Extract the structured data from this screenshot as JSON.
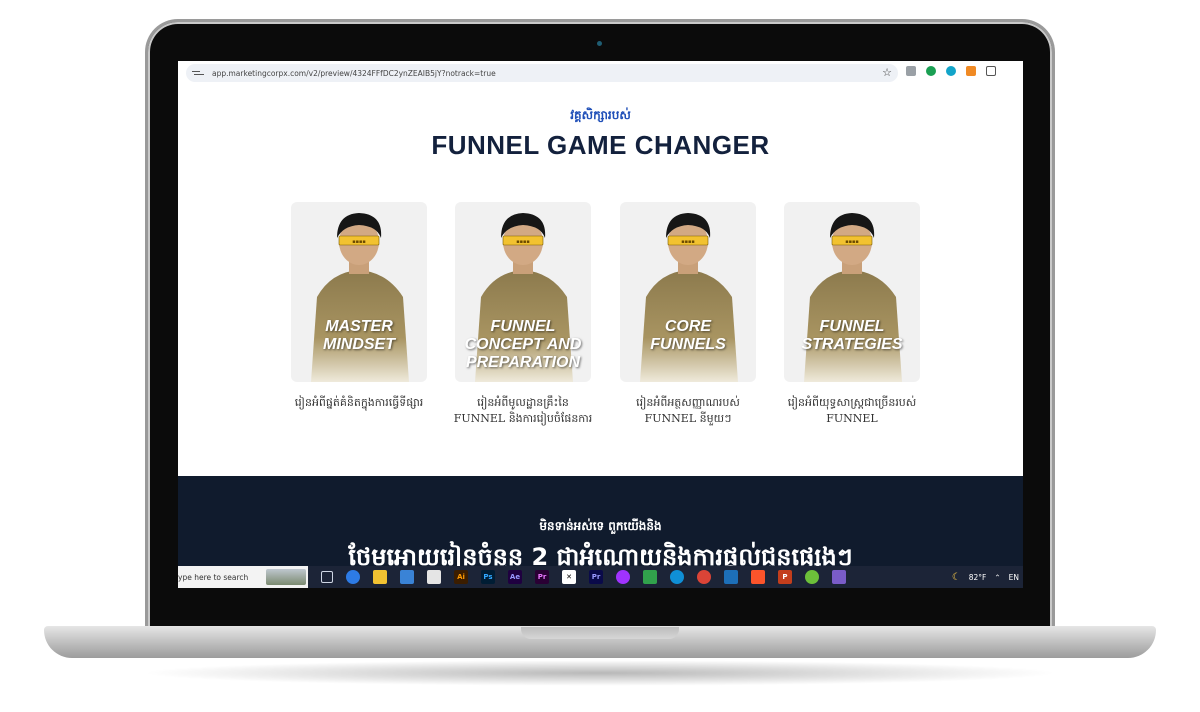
{
  "browser": {
    "url": "app.marketingcorpx.com/v2/preview/4324FFfDC2ynZEAIB5jY?notrack=true"
  },
  "page": {
    "eyebrow": "វគ្គសិក្សារបស់",
    "headline": "FUNNEL GAME CHANGER",
    "cards": [
      {
        "title_lines": [
          "MASTER",
          "MINDSET"
        ],
        "desc_lines": [
          "រៀនអំពីផ្នត់គំនិតក្នុងការធ្វើទីផ្សារ"
        ]
      },
      {
        "title_lines": [
          "FUNNEL",
          "CONCEPT AND",
          "PREPARATION"
        ],
        "desc_lines": [
          "រៀនអំពីមូលដ្ឋានគ្រឹះនៃ",
          "FUNNEL និងការរៀបចំផែនការ"
        ]
      },
      {
        "title_lines": [
          "CORE",
          "FUNNELS"
        ],
        "desc_lines": [
          "រៀនអំពីអត្ថសញ្ញាណរបស់",
          "FUNNEL នីមួយៗ"
        ]
      },
      {
        "title_lines": [
          "FUNNEL",
          "STRATEGIES"
        ],
        "desc_lines": [
          "រៀនអំពីយុទ្ធសាស្ត្រជាច្រើនរបស់",
          "FUNNEL"
        ]
      }
    ],
    "dark_section": {
      "subtitle": "មិនទាន់អស់ទេ ពួកយើងនិង",
      "title": "ថែមអោយរៀនចំនួន 2 ជាអំណោយនិងការផ្តល់ជូនផ្សេងៗ"
    }
  },
  "taskbar": {
    "search_placeholder": "ype here to search",
    "temperature": "82°F",
    "language": "EN"
  },
  "colors": {
    "accent_blue": "#1f4fb8",
    "headline_navy": "#13213d",
    "dark_section": "#101b2d"
  }
}
